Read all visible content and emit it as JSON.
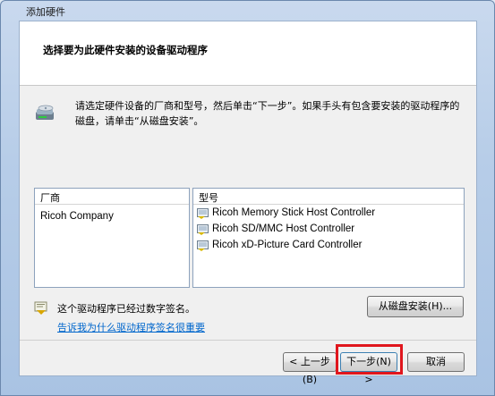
{
  "window": {
    "title": "添加硬件"
  },
  "header": {
    "title": "选择要为此硬件安装的设备驱动程序"
  },
  "info": {
    "icon": "hardware-disk-icon",
    "text": "请选定硬件设备的厂商和型号，然后单击“下一步”。如果手头有包含要安装的驱动程序的磁盘，请单击“从磁盘安装”。"
  },
  "manufacturer": {
    "header": "厂商",
    "items": [
      "Ricoh Company"
    ]
  },
  "model": {
    "header": "型号",
    "items": [
      "Ricoh Memory Stick Host Controller",
      "Ricoh SD/MMC Host Controller",
      "Ricoh xD-Picture Card Controller"
    ]
  },
  "signature": {
    "icon": "signed-driver-icon",
    "text": "这个驱动程序已经过数字签名。",
    "link": "告诉我为什么驱动程序签名很重要"
  },
  "buttons": {
    "have_disk": "从磁盘安装(H)...",
    "back": "< 上一步(B)",
    "next": "下一步(N) >",
    "cancel": "取消"
  },
  "colors": {
    "highlight": "#e0161d",
    "link": "#0066cc"
  }
}
